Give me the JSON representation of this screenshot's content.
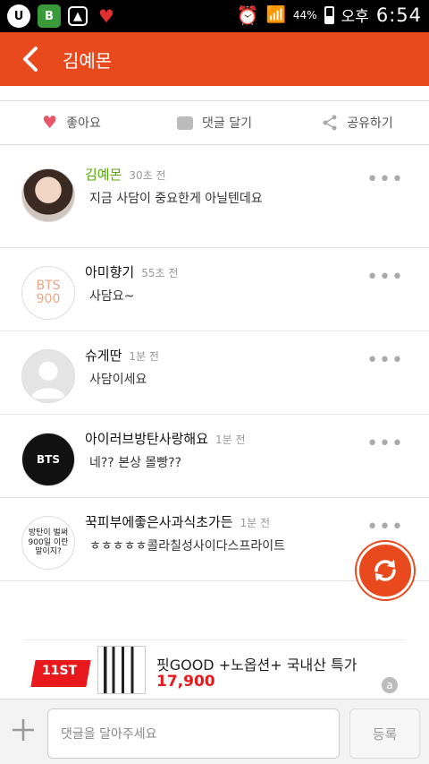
{
  "statusbar": {
    "battery": "44%",
    "ampm": "오후",
    "time": "6:54",
    "icons": [
      "u-plus-icon",
      "battery-saver-icon",
      "gallery-icon",
      "broken-heart-icon",
      "alarm-icon",
      "wifi-icon",
      "signal-icon",
      "battery-icon"
    ]
  },
  "appbar": {
    "title": "김예몬"
  },
  "actions": {
    "like": "좋아요",
    "comment": "댓글 달기",
    "share": "공유하기"
  },
  "comments": [
    {
      "name": "김예몬",
      "name_color": "#55aa00",
      "time": "30초 전",
      "text": "지금 사담이 중요한게 아닐텐데요"
    },
    {
      "name": "아미향기",
      "time": "55초 전",
      "text": "사담요~"
    },
    {
      "name": "슈게딴",
      "time": "1분 전",
      "text": "사담이세요"
    },
    {
      "name": "아이러브방탄사랑해요",
      "time": "1분 전",
      "text": "네?? 본상 몰빵??"
    },
    {
      "name": "꾹피부에좋은사과식초가든",
      "time": "1분 전",
      "text": "ㅎㅎㅎㅎㅎ콜라칠성사이다스프라이트"
    }
  ],
  "avatars": {
    "bts900": "BTS 900",
    "bts_logo": "BTS",
    "text900": "방탄이 벌써 900일 이란말이지?"
  },
  "ad": {
    "logo": "11ST",
    "title": "핏GOOD +노옵션+ 국내산 특가",
    "price": "17,900"
  },
  "input": {
    "placeholder": "댓글을 달아주세요",
    "submit": "등록"
  },
  "colors": {
    "accent": "#e8491d"
  }
}
